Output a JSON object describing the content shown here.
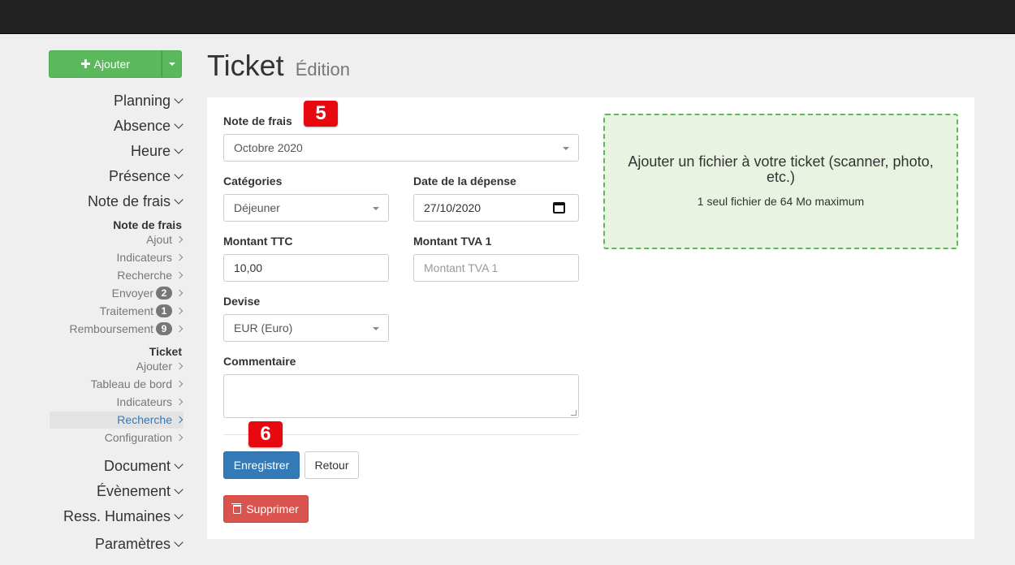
{
  "sidebar": {
    "add_label": "Ajouter",
    "main_items": {
      "planning": "Planning",
      "absence": "Absence",
      "heure": "Heure",
      "presence": "Présence",
      "note_de_frais": "Note de frais",
      "document": "Document",
      "evenement": "Évènement",
      "ress_humaines": "Ress. Humaines",
      "parametres": "Paramètres"
    },
    "ndf_section": {
      "heading": "Note de frais",
      "ajout": "Ajout",
      "indicateurs": "Indicateurs",
      "recherche": "Recherche",
      "envoyer": "Envoyer",
      "envoyer_count": "2",
      "traitement": "Traitement",
      "traitement_count": "1",
      "remboursement": "Remboursement",
      "remboursement_count": "9"
    },
    "ticket_section": {
      "heading": "Ticket",
      "ajouter": "Ajouter",
      "tableau_de_bord": "Tableau de bord",
      "indicateurs": "Indicateurs",
      "recherche": "Recherche",
      "configuration": "Configuration"
    }
  },
  "page": {
    "title": "Ticket",
    "subtitle": "Édition"
  },
  "form": {
    "note_de_frais_label": "Note de frais",
    "note_de_frais_value": "Octobre 2020",
    "categories_label": "Catégories",
    "categories_value": "Déjeuner",
    "date_label": "Date de la dépense",
    "date_value": "27/10/2020",
    "montant_ttc_label": "Montant TTC",
    "montant_ttc_value": "10,00",
    "montant_tva_label": "Montant TVA 1",
    "montant_tva_placeholder": "Montant TVA 1",
    "devise_label": "Devise",
    "devise_value": "EUR (Euro)",
    "commentaire_label": "Commentaire",
    "save_label": "Enregistrer",
    "back_label": "Retour",
    "delete_label": "Supprimer"
  },
  "dropzone": {
    "title": "Ajouter un fichier à votre ticket (scanner, photo, etc.)",
    "subtitle": "1 seul fichier de 64 Mo maximum"
  },
  "markers": {
    "m5": "5",
    "m6": "6"
  },
  "colors": {
    "success": "#5cb85c",
    "primary": "#337ab7",
    "danger": "#d9534f",
    "marker": "#e8080f"
  }
}
